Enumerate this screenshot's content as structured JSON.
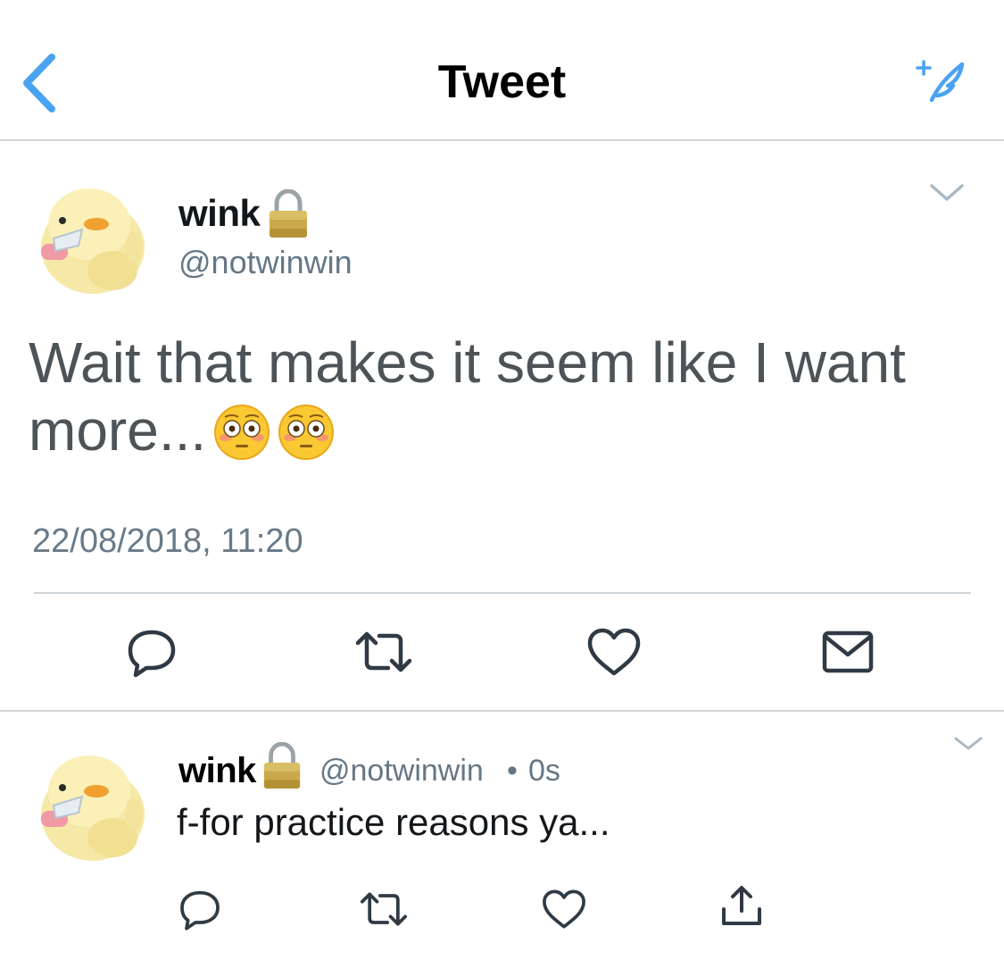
{
  "header": {
    "title": "Tweet",
    "back_icon": "chevron-left-icon",
    "compose_icon": "compose-feather-icon",
    "accent_color": "#4aa3f0"
  },
  "main_tweet": {
    "display_name": "wink",
    "handle": "@notwinwin",
    "text": "Wait that makes it seem like I want more...",
    "emojis": [
      "flushed-face",
      "flushed-face"
    ],
    "timestamp": "22/08/2018, 11:20",
    "protected": true,
    "actions": [
      "reply-icon",
      "retweet-icon",
      "like-icon",
      "direct-message-icon"
    ]
  },
  "reply_tweet": {
    "display_name": "wink",
    "handle": "@notwinwin",
    "separator": "•",
    "time": "0s",
    "text": "f-for practice reasons ya...",
    "protected": true,
    "actions": [
      "reply-icon",
      "retweet-icon",
      "like-icon",
      "share-icon"
    ]
  }
}
